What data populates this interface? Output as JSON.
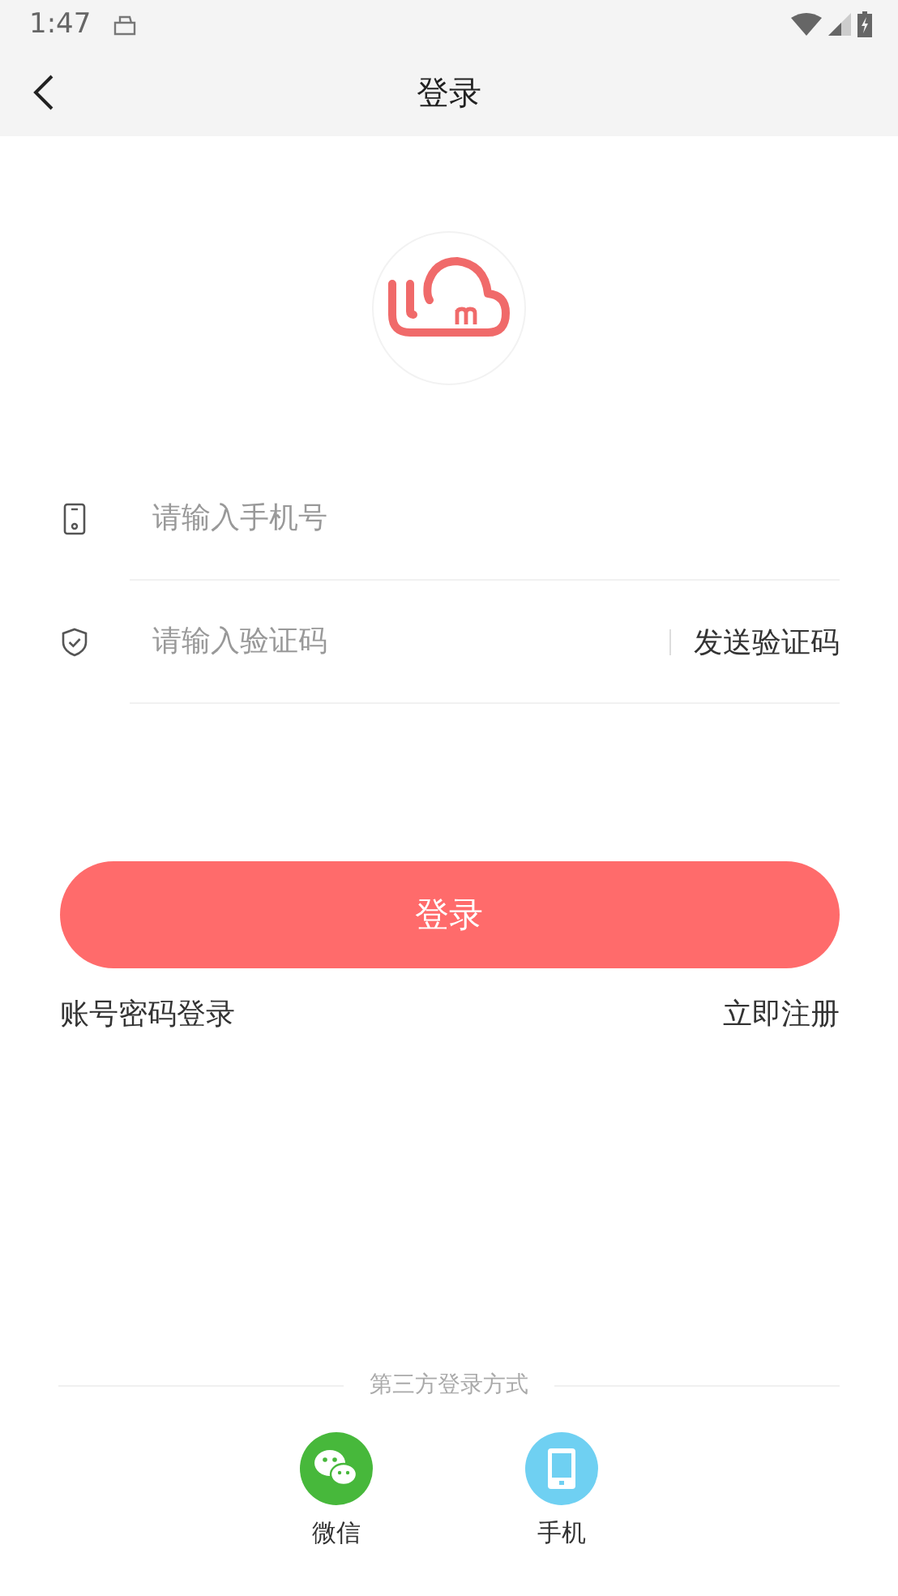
{
  "status_bar": {
    "time": "1:47"
  },
  "nav": {
    "title": "登录"
  },
  "fields": [
    {
      "kind": "phone",
      "placeholder": "请输入手机号"
    },
    {
      "kind": "code",
      "placeholder": "请输入验证码",
      "action": "发送验证码"
    }
  ],
  "login_button": "登录",
  "links": {
    "left": "账号密码登录",
    "right": "立即注册"
  },
  "third_party": {
    "label": "第三方登录方式",
    "providers": [
      {
        "kind": "wechat",
        "label": "微信"
      },
      {
        "kind": "phone",
        "label": "手机"
      }
    ]
  }
}
